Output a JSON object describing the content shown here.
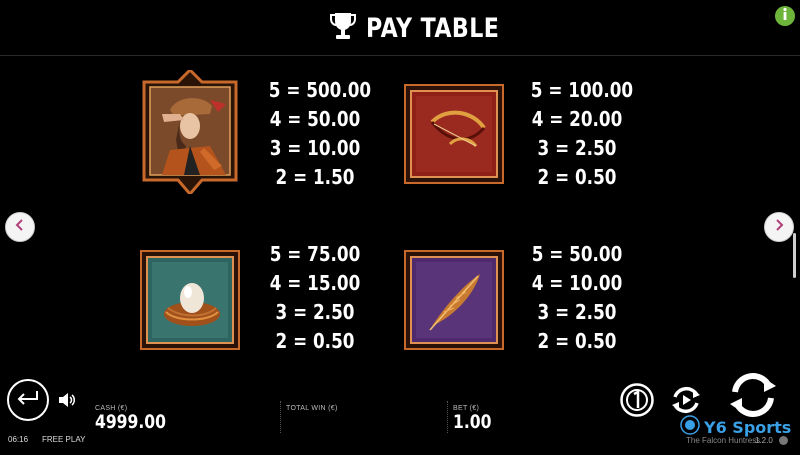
{
  "header": {
    "title": "PAY TABLE",
    "title_icon": "trophy-icon",
    "info_icon": "info-icon",
    "info_color": "#6db43a"
  },
  "navigation": {
    "prev_icon": "chevron-left-icon",
    "next_icon": "chevron-right-icon",
    "arrow_color": "#b0407a"
  },
  "symbols": [
    {
      "name": "huntress",
      "pays": [
        "5 = 500.00",
        "4 = 50.00",
        "3 = 10.00",
        "2 = 1.50"
      ]
    },
    {
      "name": "bow",
      "pays": [
        "5 = 100.00",
        "4 = 20.00",
        "3 = 2.50",
        "2 = 0.50"
      ]
    },
    {
      "name": "egg-nest",
      "pays": [
        "5 = 75.00",
        "4 = 15.00",
        "3 = 2.50",
        "2 = 0.50"
      ]
    },
    {
      "name": "feather",
      "pays": [
        "5 = 50.00",
        "4 = 10.00",
        "3 = 2.50",
        "2 = 0.50"
      ]
    }
  ],
  "footer": {
    "cash_label": "CASH (€)",
    "cash_value": "4999.00",
    "total_win_label": "TOTAL WIN (€)",
    "total_win_value": "",
    "bet_label": "BET (€)",
    "bet_value": "1.00",
    "clock": "06:16",
    "mode": "FREE PLAY",
    "game_name": "The Falcon Huntress",
    "version": "1.2.0",
    "watermark": "Y6 Sports"
  }
}
